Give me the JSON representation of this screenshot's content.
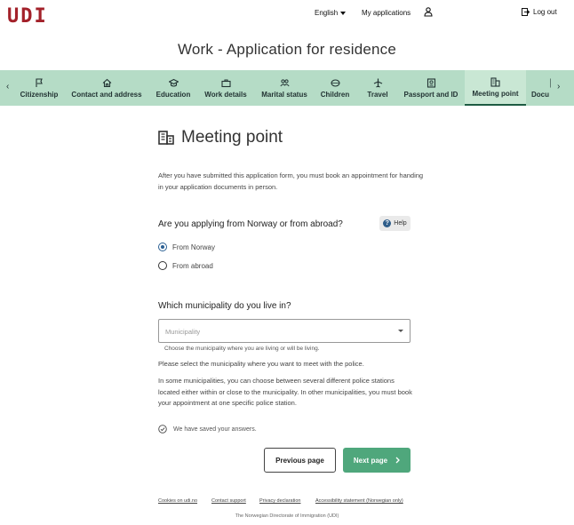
{
  "header": {
    "logo": "UDI",
    "language": "English",
    "my_applications": "My applications",
    "logout": "Log out"
  },
  "page_title": "Work - Application for residence",
  "steps": [
    {
      "label": "Citizenship",
      "icon": "flag-icon"
    },
    {
      "label": "Contact and address",
      "icon": "house-icon"
    },
    {
      "label": "Education",
      "icon": "graduation-cap-icon"
    },
    {
      "label": "Work details",
      "icon": "briefcase-icon"
    },
    {
      "label": "Marital status",
      "icon": "people-icon"
    },
    {
      "label": "Children",
      "icon": "child-face-icon"
    },
    {
      "label": "Travel",
      "icon": "airplane-icon"
    },
    {
      "label": "Passport and ID",
      "icon": "passport-icon"
    },
    {
      "label": "Meeting point",
      "icon": "building-icon",
      "active": true
    },
    {
      "label": "Docu",
      "icon": "document-icon"
    }
  ],
  "section": {
    "heading": "Meeting point",
    "intro": "After you have submitted this application form, you must book an appointment for handing in your application documents in person."
  },
  "question1": {
    "label": "Are you applying from Norway or from abroad?",
    "help": "Help",
    "options": [
      {
        "label": "From Norway",
        "selected": true
      },
      {
        "label": "From abroad",
        "selected": false
      }
    ]
  },
  "question2": {
    "label": "Which municipality do you live in?",
    "placeholder": "Municipality",
    "hint": "Choose the municipality where you are living or will be living."
  },
  "info": {
    "p1": "Please select the municipality where you want to meet with the police.",
    "p2": "In some municipalities, you can choose between several different police stations located either within or close to the municipality. In other municipalities, you must book your appointment at one specific police station."
  },
  "saved_status": "We have saved your answers.",
  "buttons": {
    "previous": "Previous page",
    "next": "Next page"
  },
  "footer": {
    "links": [
      "Cookies on udi.no",
      "Contact support",
      "Privacy declaration",
      "Accessibility statement (Norwegian only)"
    ],
    "org": "The Norwegian Directorate of Immigration (UDI)"
  },
  "colors": {
    "brand": "#a3212a",
    "stepbar": "#b5dcc6",
    "primary_button": "#4fa77c",
    "radio_selected": "#2a5f93"
  }
}
